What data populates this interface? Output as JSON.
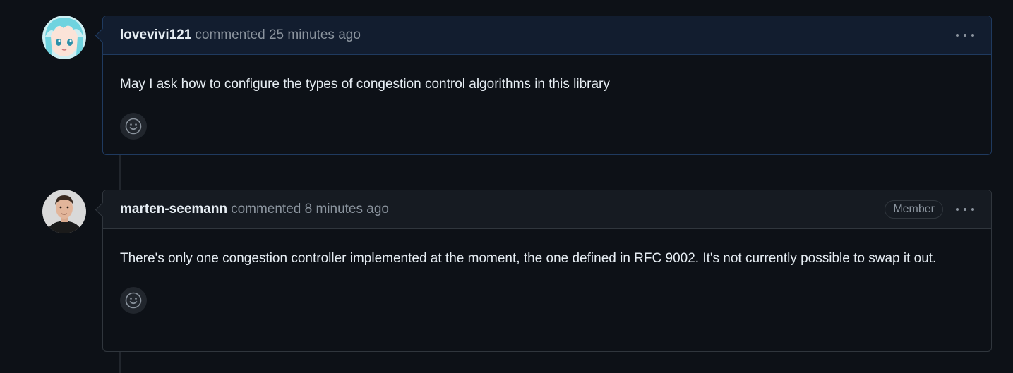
{
  "comments": [
    {
      "author": "lovevivi121",
      "meta": "commented 25 minutes ago",
      "badge": "",
      "body": "May I ask how to configure the types of congestion control algorithms in this library",
      "avatar_icon": "anime-avatar"
    },
    {
      "author": "marten-seemann",
      "meta": "commented 8 minutes ago",
      "badge": "Member",
      "body": "There's only one congestion controller implemented at the moment, the one defined in RFC 9002. It's not currently possible to swap it out.",
      "avatar_icon": "person-avatar"
    }
  ],
  "icons": {
    "more_actions": "kebab-horizontal-icon",
    "reaction": "smiley-icon"
  },
  "colors": {
    "background": "#0d1117",
    "border": "#30363d",
    "highlight_border": "#1f3a5f",
    "text": "#e6edf3",
    "muted": "#8b949e"
  }
}
